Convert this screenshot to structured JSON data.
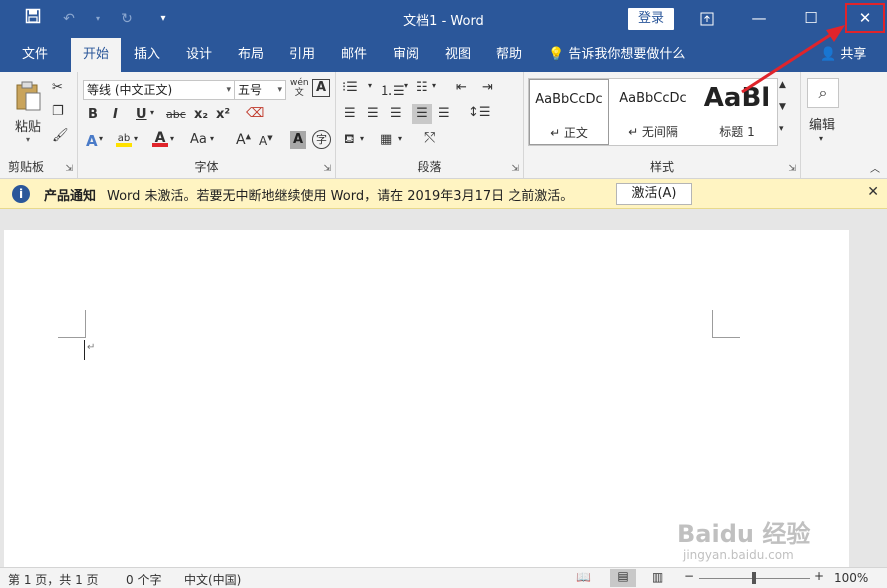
{
  "window": {
    "title": "文档1 - Word",
    "login_label": "登录",
    "qat": {
      "save_icon": "save-icon",
      "undo_icon": "undo-icon",
      "redo_icon": "redo-icon",
      "customize_icon": "customize-qat-icon"
    }
  },
  "tabs": [
    {
      "label": "文件"
    },
    {
      "label": "开始"
    },
    {
      "label": "插入"
    },
    {
      "label": "设计"
    },
    {
      "label": "布局"
    },
    {
      "label": "引用"
    },
    {
      "label": "邮件"
    },
    {
      "label": "审阅"
    },
    {
      "label": "视图"
    },
    {
      "label": "帮助"
    }
  ],
  "tell_me": "告诉我你想要做什么",
  "share_label": "共享",
  "ribbon": {
    "clipboard": {
      "paste_label": "粘贴",
      "group_label": "剪贴板"
    },
    "font": {
      "font_name": "等线 (中文正文)",
      "font_size": "五号",
      "group_label": "字体",
      "bold": "B",
      "italic": "I",
      "underline": "U",
      "strike": "abc",
      "subscript": "x₂",
      "superscript": "x²",
      "grow": "A",
      "shrink": "A",
      "case": "Aa",
      "wen": "wén",
      "box_a": "A",
      "circle_char": "字"
    },
    "paragraph": {
      "group_label": "段落"
    },
    "styles": {
      "group_label": "样式",
      "items": [
        {
          "sample": "AaBbCcDc",
          "name": "↵ 正文"
        },
        {
          "sample": "AaBbCcDc",
          "name": "↵ 无间隔"
        },
        {
          "sample": "AaBl",
          "name": "标题 1"
        }
      ]
    },
    "editing": {
      "label": "编辑"
    }
  },
  "notification": {
    "title": "产品通知",
    "message": "Word 未激活。若要无中断地继续使用 Word，请在 2019年3月17日 之前激活。",
    "activate_label": "激活(A)"
  },
  "status": {
    "page": "第 1 页，共 1 页",
    "words": "0 个字",
    "language": "中文(中国)",
    "zoom_minus": "−",
    "zoom_plus": "+",
    "zoom": "100%"
  },
  "watermark": {
    "main": "Baidu 经验",
    "sub": "jingyan.baidu.com"
  },
  "colors": {
    "titlebar": "#2b579a",
    "accent": "#2b579a",
    "highlight_red": "#e0242b",
    "notification_bg": "#fff4c2"
  }
}
